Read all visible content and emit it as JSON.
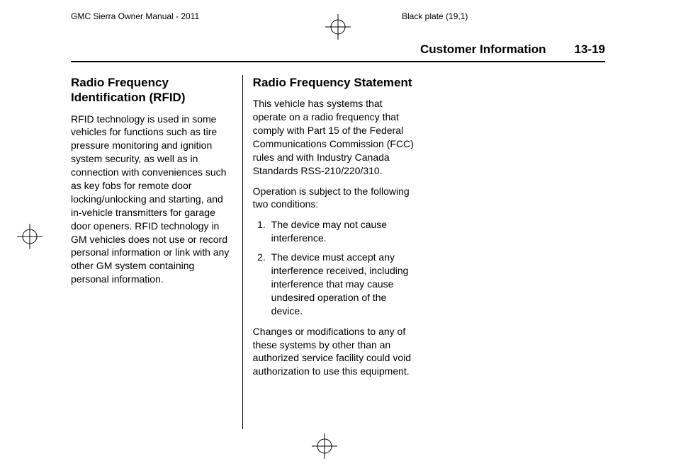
{
  "printHeader": {
    "left": "GMC Sierra Owner Manual - 2011",
    "right": "Black plate (19,1)"
  },
  "topBar": {
    "sectionName": "Customer Information",
    "pageNumber": "13-19"
  },
  "column1": {
    "heading": "Radio Frequency Identification (RFID)",
    "para1": "RFID technology is used in some vehicles for functions such as tire pressure monitoring and ignition system security, as well as in connection with conveniences such as key fobs for remote door locking/unlocking and starting, and in-vehicle transmitters for garage door openers. RFID technology in GM vehicles does not use or record personal information or link with any other GM system containing personal information."
  },
  "column2": {
    "heading": "Radio Frequency Statement",
    "para1": "This vehicle has systems that operate on a radio frequency that comply with Part 15 of the Federal Communications Commission (FCC) rules and with Industry Canada Standards RSS-210/220/310.",
    "para2": "Operation is subject to the following two conditions:",
    "li1": "The device may not cause interference.",
    "li2": "The device must accept any interference received, including interference that may cause undesired operation of the device.",
    "para3": "Changes or modifications to any of these systems by other than an authorized service facility could void authorization to use this equipment."
  }
}
